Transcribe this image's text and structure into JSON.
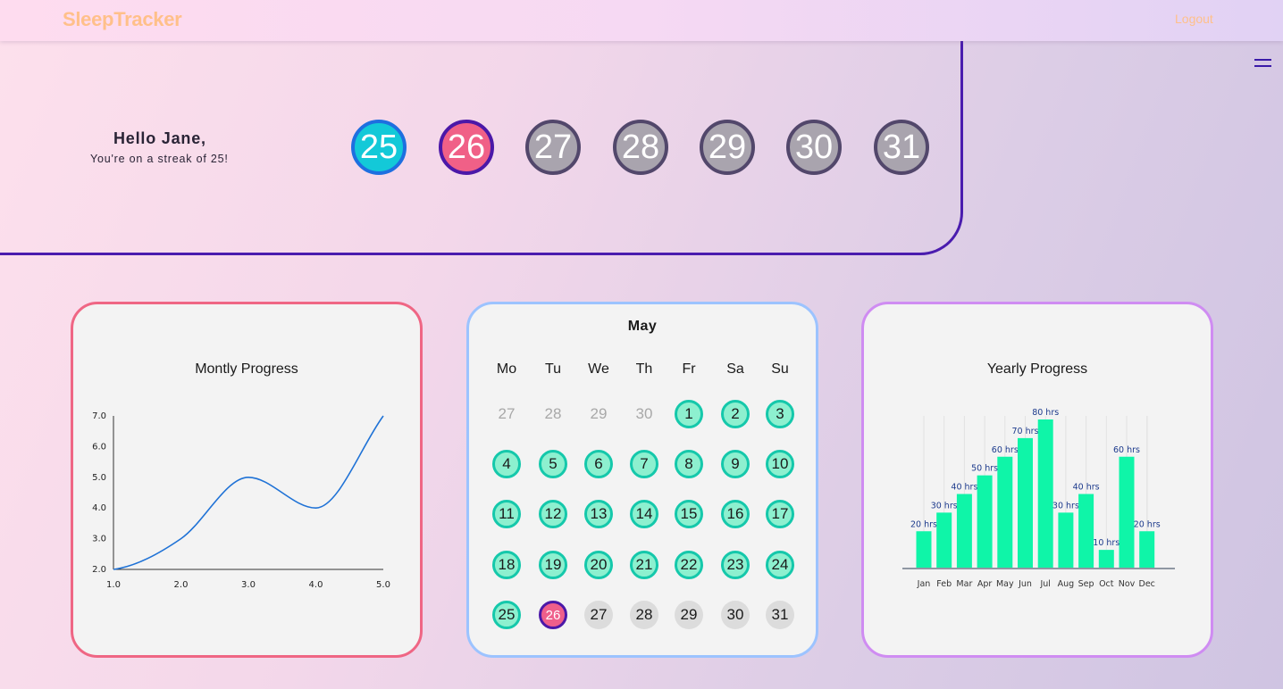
{
  "navbar": {
    "brand": "SleepTracker",
    "logout_label": "Logout"
  },
  "greeting": {
    "name_line": "Hello Jane,",
    "streak_line": "You're on a streak of 25!"
  },
  "week_days": [
    {
      "label": "25",
      "status": "done"
    },
    {
      "label": "26",
      "status": "today"
    },
    {
      "label": "27",
      "status": "future"
    },
    {
      "label": "28",
      "status": "future"
    },
    {
      "label": "29",
      "status": "future"
    },
    {
      "label": "30",
      "status": "future"
    },
    {
      "label": "31",
      "status": "future"
    }
  ],
  "colors": {
    "brand": "#ffc08a",
    "hero_border": "#4a1cae",
    "done_fill": "#13c9d8",
    "today_fill": "#f06087",
    "future_fill": "#a9a4ae",
    "calendar_done": "#8df0cf",
    "bar_fill": "#0ff5a8",
    "line_color": "#1f72d6"
  },
  "monthly": {
    "title": "Montly Progress"
  },
  "calendar": {
    "month": "May",
    "weekdays": [
      "Mo",
      "Tu",
      "We",
      "Th",
      "Fr",
      "Sa",
      "Su"
    ],
    "weeks": [
      [
        [
          "27",
          "prev"
        ],
        [
          "28",
          "prev"
        ],
        [
          "29",
          "prev"
        ],
        [
          "30",
          "prev"
        ],
        [
          "1",
          "done"
        ],
        [
          "2",
          "done"
        ],
        [
          "3",
          "done"
        ]
      ],
      [
        [
          "4",
          "done"
        ],
        [
          "5",
          "done"
        ],
        [
          "6",
          "done"
        ],
        [
          "7",
          "done"
        ],
        [
          "8",
          "done"
        ],
        [
          "9",
          "done"
        ],
        [
          "10",
          "done"
        ]
      ],
      [
        [
          "11",
          "done"
        ],
        [
          "12",
          "done"
        ],
        [
          "13",
          "done"
        ],
        [
          "14",
          "done"
        ],
        [
          "15",
          "done"
        ],
        [
          "16",
          "done"
        ],
        [
          "17",
          "done"
        ]
      ],
      [
        [
          "18",
          "done"
        ],
        [
          "19",
          "done"
        ],
        [
          "20",
          "done"
        ],
        [
          "21",
          "done"
        ],
        [
          "22",
          "done"
        ],
        [
          "23",
          "done"
        ],
        [
          "24",
          "done"
        ]
      ],
      [
        [
          "25",
          "done"
        ],
        [
          "26",
          "today"
        ],
        [
          "27",
          "future"
        ],
        [
          "28",
          "future"
        ],
        [
          "29",
          "future"
        ],
        [
          "30",
          "future"
        ],
        [
          "31",
          "future"
        ]
      ]
    ]
  },
  "yearly": {
    "title": "Yearly Progress"
  },
  "chart_data": [
    {
      "type": "line",
      "title": "Montly Progress",
      "x": [
        1.0,
        2.0,
        3.0,
        4.0,
        5.0
      ],
      "y": [
        2.0,
        3.0,
        5.0,
        4.0,
        7.0
      ],
      "xticks": [
        "1.0",
        "2.0",
        "3.0",
        "4.0",
        "5.0"
      ],
      "yticks": [
        "2.0",
        "3.0",
        "4.0",
        "5.0",
        "6.0",
        "7.0"
      ],
      "xlim": [
        1.0,
        5.0
      ],
      "ylim": [
        2.0,
        7.0
      ],
      "grid": false
    },
    {
      "type": "bar",
      "title": "Yearly Progress",
      "categories": [
        "Jan",
        "Feb",
        "Mar",
        "Apr",
        "May",
        "Jun",
        "Jul",
        "Aug",
        "Sep",
        "Oct",
        "Nov",
        "Dec"
      ],
      "values": [
        20,
        30,
        40,
        50,
        60,
        70,
        80,
        30,
        40,
        10,
        60,
        20
      ],
      "data_labels": [
        "20 hrs",
        "30 hrs",
        "40 hrs",
        "50 hrs",
        "60 hrs",
        "70 hrs",
        "80 hrs",
        "30 hrs",
        "40 hrs",
        "10 hrs",
        "60 hrs",
        "20 hrs"
      ],
      "ylim": [
        0,
        80
      ],
      "grid": true
    }
  ]
}
